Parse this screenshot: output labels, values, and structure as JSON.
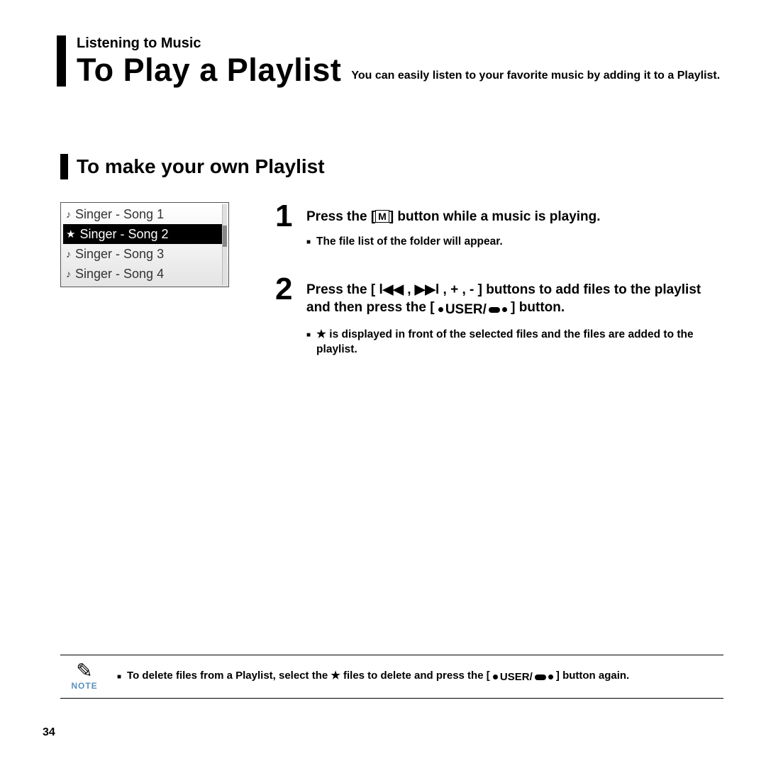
{
  "header": {
    "section": "Listening to Music",
    "title": "To Play a Playlist",
    "lead": "You can easily listen to your favorite music by adding it to a Playlist."
  },
  "sub_heading": "To make your own Playlist",
  "device": {
    "items": [
      {
        "icon": "note",
        "label": "Singer - Song 1",
        "selected": false
      },
      {
        "icon": "star",
        "label": "Singer - Song 2",
        "selected": true
      },
      {
        "icon": "note",
        "label": "Singer - Song 3",
        "selected": false
      },
      {
        "icon": "note",
        "label": "Singer - Song 4",
        "selected": false
      }
    ]
  },
  "steps": [
    {
      "num": "1",
      "text_before": "Press the [",
      "text_after": "] button while a music is playing.",
      "sub": "The file list of the folder will appear."
    },
    {
      "num": "2",
      "text_a": "Press the [ ",
      "nav": "l◀◀ , ▶▶l , + , -",
      "text_b": " ] buttons to add files to the playlist and then press the [ ",
      "user_label": "USER/",
      "text_c": " ] button.",
      "sub": "is displayed in front of the selected files and the files are added to the playlist."
    }
  ],
  "note": {
    "label": "NOTE",
    "text_a": "To delete files from a Playlist, select the ",
    "text_b": " files to delete and press the [ ",
    "user_label": "USER/",
    "text_c": " ] button again."
  },
  "page_number": "34"
}
